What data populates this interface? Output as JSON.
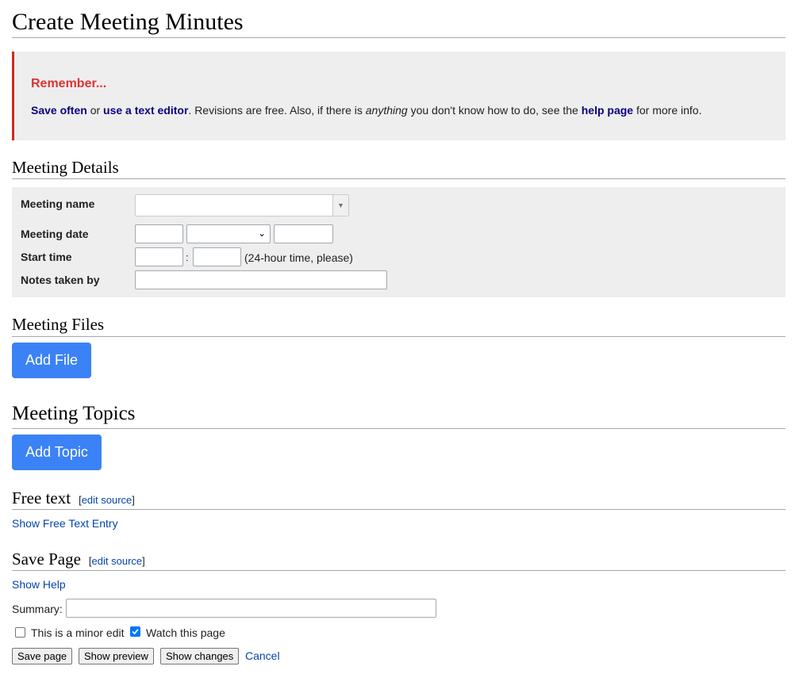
{
  "page": {
    "title": "Create Meeting Minutes"
  },
  "notice": {
    "title": "Remember...",
    "save_often": "Save often",
    "or": "or",
    "use_text_editor": "use a text editor",
    "text1": ". Revisions are free. Also, if there is",
    "anything": "anything",
    "text2": "you don't know how to do, see the",
    "help_page": "help page",
    "text3": "for more info."
  },
  "details": {
    "heading": "Meeting Details",
    "meeting_name_label": "Meeting name",
    "meeting_name_value": "",
    "meeting_date_label": "Meeting date",
    "day_value": "",
    "month_value": "",
    "year_value": "",
    "start_time_label": "Start time",
    "hour_value": "",
    "time_separator": ":",
    "minute_value": "",
    "time_hint": "(24-hour time, please)",
    "notes_taken_by_label": "Notes taken by",
    "notes_taken_by_value": ""
  },
  "files": {
    "heading": "Meeting Files",
    "add_label": "Add File"
  },
  "topics": {
    "heading": "Meeting Topics",
    "add_label": "Add Topic"
  },
  "free_text": {
    "heading": "Free text",
    "bracket_open": "[",
    "edit_source": "edit source",
    "bracket_close": "]",
    "show_entry": "Show Free Text Entry"
  },
  "save_section": {
    "heading": "Save Page",
    "bracket_open": "[",
    "edit_source": "edit source",
    "bracket_close": "]",
    "show_help": "Show Help",
    "summary_label": "Summary:",
    "summary_value": "",
    "minor_edit_label": "This is a minor edit",
    "minor_edit_checked": false,
    "watch_label": "Watch this page",
    "watch_checked": true,
    "save_button": "Save page",
    "preview_button": "Show preview",
    "changes_button": "Show changes",
    "cancel_link": "Cancel"
  },
  "colors": {
    "accent_button": "#3b82f6",
    "link": "#0645ad",
    "notice_title": "#dd3333",
    "notice_border": "#cc2a22",
    "panel_bg": "#eeeeee",
    "checkbox_checked": "#0075ff"
  }
}
